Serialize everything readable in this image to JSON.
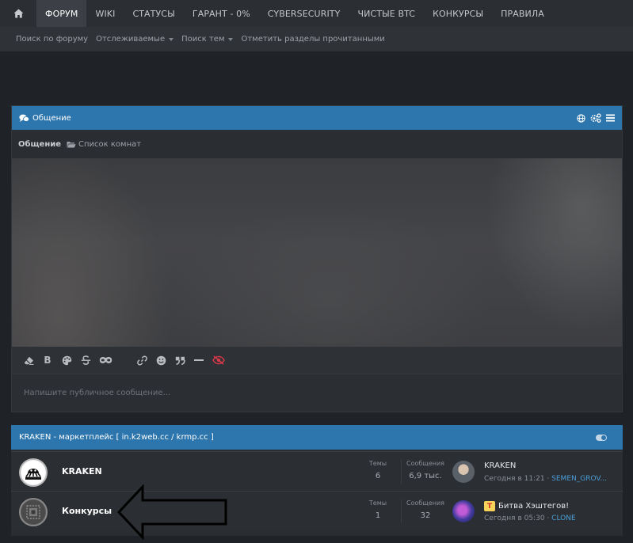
{
  "nav": {
    "home_icon": "home-icon",
    "items": [
      "ФОРУМ",
      "WIKI",
      "СТАТУСЫ",
      "ГАРАНТ - 0%",
      "CYBERSECURITY",
      "ЧИСТЫЕ BTC",
      "КОНКУРСЫ",
      "ПРАВИЛА"
    ],
    "active": "ФОРУМ"
  },
  "subnav": {
    "items": [
      "Поиск по форуму",
      "Отслеживаемые",
      "Поиск тем",
      "Отметить разделы прочитанными"
    ]
  },
  "chat": {
    "title": "Общение",
    "crumb_current": "Общение",
    "crumb_rooms": "Список комнат",
    "placeholder": "Напишите публичное сообщение..."
  },
  "category": {
    "title": "KRAKEN - маркетплейс [ in.k2web.cc / krmp.cc ]",
    "nodes": [
      {
        "title": "KRAKEN",
        "themes_label": "Темы",
        "themes": "6",
        "messages_label": "Сообщения",
        "messages": "6,9 тыс.",
        "last_title": "KRAKEN",
        "last_time": "Сегодня в 11:21",
        "last_user": "SEMEN_GROV..."
      },
      {
        "title": "Конкурсы",
        "themes_label": "Темы",
        "themes": "1",
        "messages_label": "Сообщения",
        "messages": "32",
        "last_prefix": "T",
        "last_title": "Битва Хэштегов!",
        "last_time": "Сегодня в 05:30",
        "last_user": "CLONE"
      }
    ]
  },
  "colors": {
    "accent": "#2d75ad",
    "link": "#4a9fd8",
    "background": "#1f2226"
  }
}
